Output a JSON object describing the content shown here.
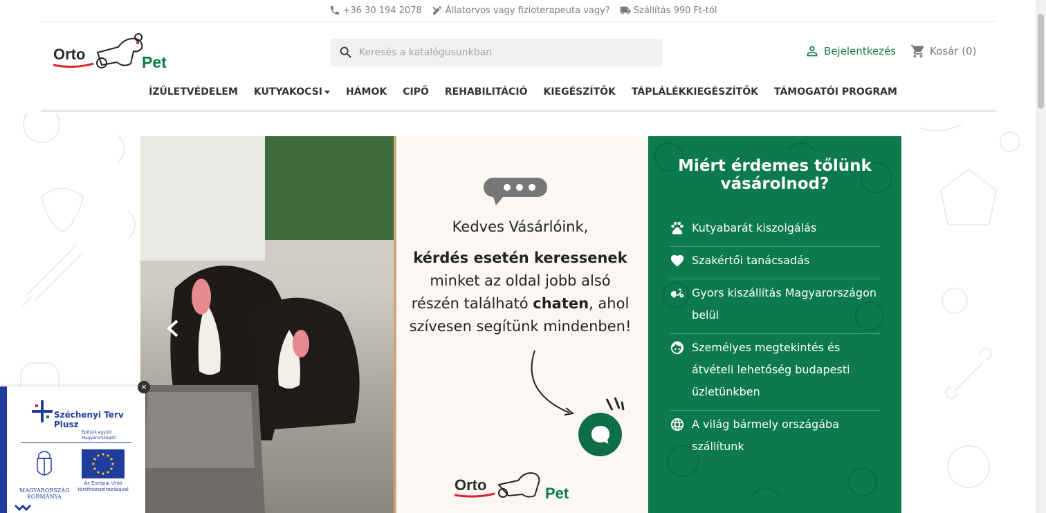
{
  "topbar": {
    "phone": "+36 30 194 2078",
    "vet": "Állatorvos vagy fizioterapeuta vagy?",
    "shipping": "Szállítás 990 Ft-tól"
  },
  "logo": {
    "left": "Orto",
    "right": "Pet"
  },
  "search": {
    "placeholder": "Keresés a katalógusunkban"
  },
  "account": {
    "login": "Bejelentkezés",
    "cart": "Kosár (0)"
  },
  "nav": {
    "items": [
      "ÍZÜLETVÉDELEM",
      "KUTYAKOCSI",
      "HÁMOK",
      "CIPŐ",
      "REHABILITÁCIÓ",
      "KIEGÉSZÍTŐK",
      "TÁPLÁLÉKKIEGÉSZÍTŐK",
      "TÁMOGATÓI PROGRAM"
    ]
  },
  "banner": {
    "line1": "Kedves Vásárlóink,",
    "line2": "kérdés esetén keressenek",
    "line3": "minket az oldal jobb alsó",
    "line4a": "részén található ",
    "line4b": "chaten",
    "line4c": ", ahol",
    "line5": "szívesen segítünk mindenben!"
  },
  "why": {
    "title": "Miért érdemes tőlünk vásárolnod?",
    "items": [
      {
        "icon": "paw-icon",
        "text": "Kutyabarát kiszolgálás"
      },
      {
        "icon": "heart-icon",
        "text": "Szakértői tanácsadás"
      },
      {
        "icon": "scooter-icon",
        "text": "Gyors kiszállítás Magyarországon belül"
      },
      {
        "icon": "smile-icon",
        "text": "Személyes megtekintés és átvételi lehetőség budapesti üzletünkben"
      },
      {
        "icon": "globe-icon",
        "text": "A világ bármely országába szállítunk"
      }
    ]
  },
  "szechenyi": {
    "close": "×",
    "title1": "Széchenyi Terv",
    "title2": "Plusz",
    "subtitle": "Építsük együtt Magyarországot!",
    "hu1": "MAGYARORSZÁG",
    "hu2": "KORMÁNYA",
    "eu1": "Az Európai Unió",
    "eu2": "társfinanszírozásával"
  },
  "colors": {
    "brand_green": "#0c7a4d",
    "login_green": "#1c7a4e",
    "eu_blue": "#1f3c9e"
  }
}
